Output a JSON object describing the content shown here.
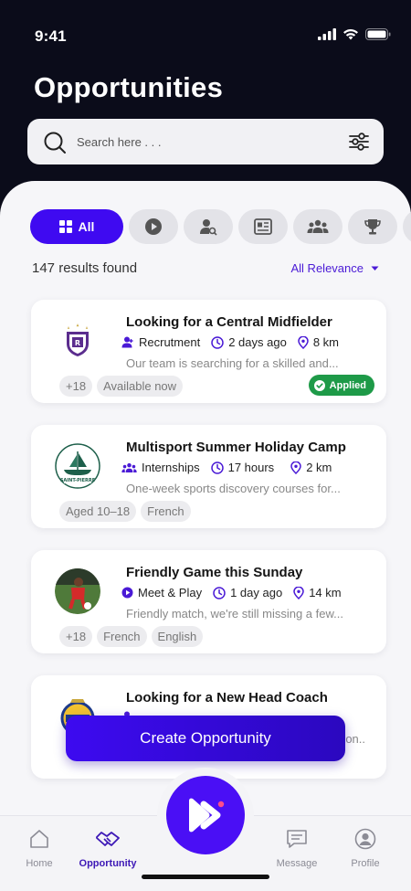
{
  "status_bar": {
    "time": "9:41"
  },
  "page": {
    "title": "Opportunities"
  },
  "search": {
    "placeholder": "Search here . . ."
  },
  "filters": {
    "chips": [
      {
        "label": "All",
        "icon": "grid-icon",
        "active": true
      },
      {
        "label": "",
        "icon": "play-icon"
      },
      {
        "label": "",
        "icon": "person-search-icon"
      },
      {
        "label": "",
        "icon": "news-card-icon"
      },
      {
        "label": "",
        "icon": "group-icon"
      },
      {
        "label": "",
        "icon": "trophy-icon"
      }
    ]
  },
  "results": {
    "count_text": "147 results found",
    "sort_label": "All Relevance"
  },
  "cards": [
    {
      "title": "Looking for a Central Midfielder",
      "category": "Recrutment",
      "category_icon": "user-plus-icon",
      "time": "2 days ago",
      "distance": "8 km",
      "description": "Our team is searching for a skilled and...",
      "tags": [
        "+18",
        "Available now"
      ],
      "status": "Applied"
    },
    {
      "title": "Multisport Summer Holiday Camp",
      "category": "Internships",
      "category_icon": "group-icon",
      "time": "17 hours",
      "distance": "2 km",
      "description": "One-week sports discovery courses for...",
      "tags": [
        "Aged 10–18",
        "French"
      ],
      "status": ""
    },
    {
      "title": "Friendly Game this Sunday",
      "category": "Meet & Play",
      "category_icon": "play-circle-icon",
      "time": "1 day ago",
      "distance": "14 km",
      "description": "Friendly match, we're still missing a few...",
      "tags": [
        "+18",
        "French",
        "English"
      ],
      "status": ""
    },
    {
      "title": "Looking for a New Head Coach",
      "category": "",
      "category_icon": "user-plus-icon",
      "time": "",
      "distance": "",
      "description": "son..",
      "tags": [],
      "status": ""
    }
  ],
  "cta": {
    "label": "Create Opportunity"
  },
  "nav": {
    "home": "Home",
    "opportunity": "Opportunity",
    "message": "Message",
    "profile": "Profile"
  },
  "colors": {
    "primary": "#3f0af1",
    "applied": "#1e9a48",
    "header_bg": "#0b0c1a"
  }
}
